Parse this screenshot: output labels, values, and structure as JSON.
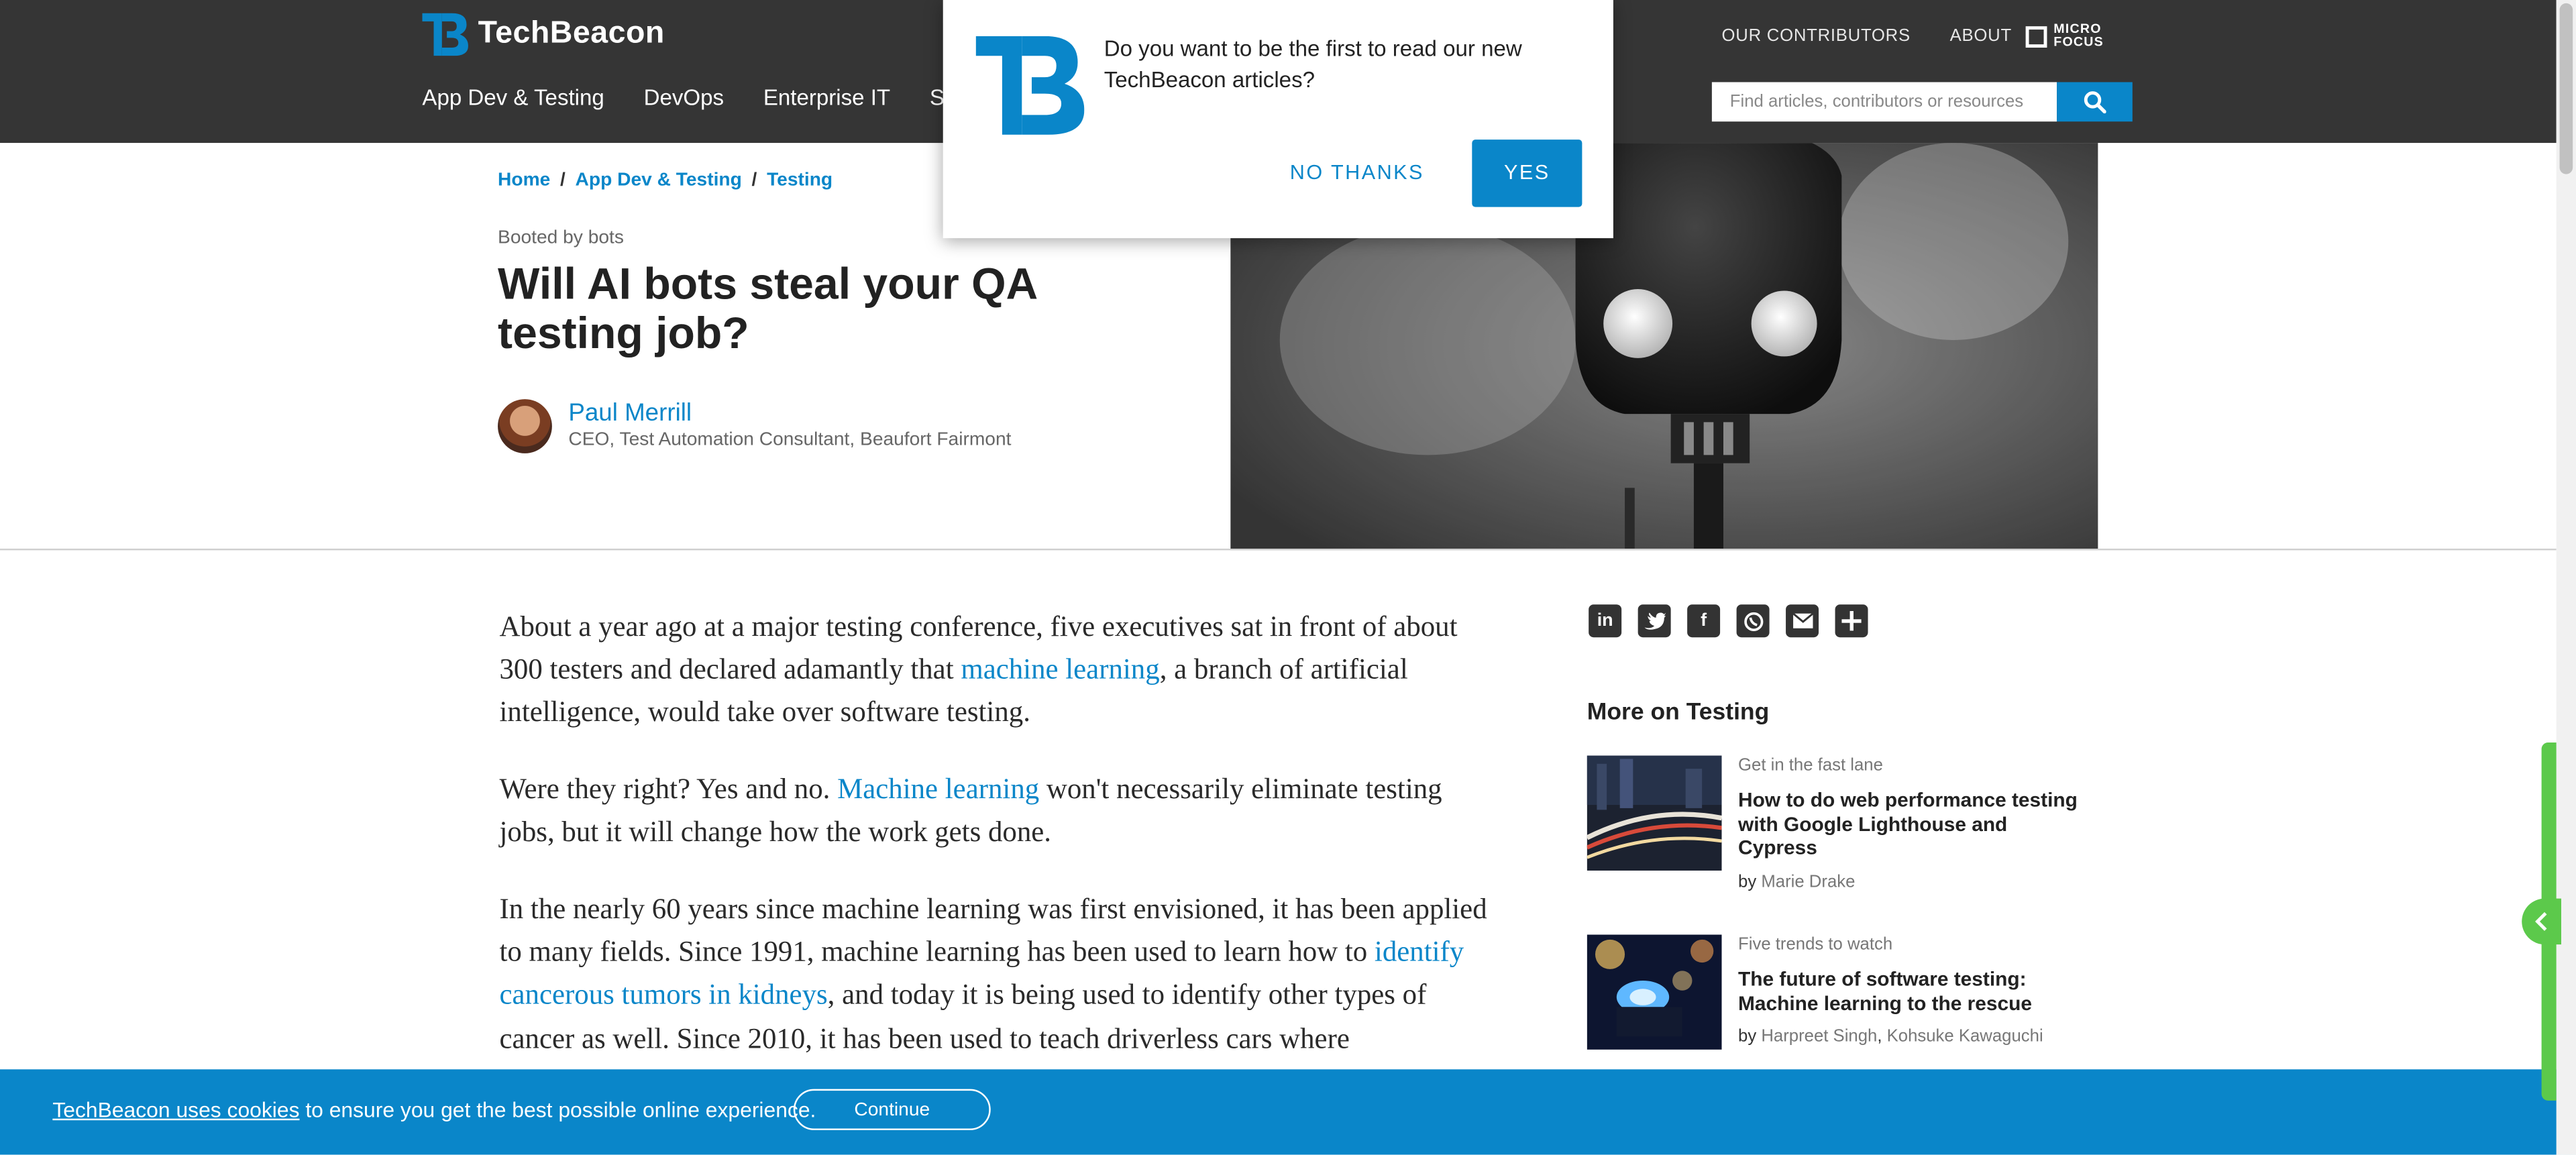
{
  "site": {
    "logo_text": "TechBeacon",
    "nav": [
      "App Dev & Testing",
      "DevOps",
      "Enterprise IT",
      "Sec"
    ],
    "top_links": [
      "OUR CONTRIBUTORS",
      "ABOUT"
    ],
    "partner_logo_text": [
      "MICRO",
      "FOCUS"
    ],
    "search_placeholder": "Find articles, contributors or resources"
  },
  "breadcrumb": {
    "items": [
      "Home",
      "App Dev & Testing",
      "Testing"
    ],
    "separator": "/"
  },
  "article": {
    "kicker": "Booted by bots",
    "title": "Will AI bots steal your QA testing job?",
    "author_name": "Paul Merrill",
    "author_role": "CEO, Test Automation Consultant, Beaufort Fairmont",
    "p1": {
      "a": "About a year ago at a major testing conference, five executives sat in front of about 300 testers and declared adamantly that ",
      "link": "machine learning",
      "b": ", a branch of artificial intelligence, would take over software testing."
    },
    "p2": {
      "a": "Were they right? Yes and no. ",
      "link": "Machine learning",
      "b": " won't necessarily eliminate testing jobs, but it will change how the work gets done."
    },
    "p3": {
      "a": "In the nearly 60 years since machine learning was first envisioned, it has been applied to many fields. Since 1991, machine learning has been used to learn how to ",
      "link": "identify cancerous tumors in kidneys",
      "b": ", and today it is being used to identify other types of cancer as well. Since 2010, it has been used to teach driverless cars where"
    }
  },
  "sidebar": {
    "share_icons": [
      "linkedin-icon",
      "twitter-icon",
      "facebook-icon",
      "whatsapp-icon",
      "email-icon",
      "plus-icon"
    ],
    "more_title": "More on Testing",
    "cards": [
      {
        "kicker": "Get in the fast lane",
        "title": "How to do web performance testing with Google Lighthouse and Cypress",
        "by": "by",
        "authors": [
          "Marie Drake"
        ]
      },
      {
        "kicker": "Five trends to watch",
        "title": "The future of software testing: Machine learning to the rescue",
        "by": "by",
        "authors": [
          "Harpreet Singh",
          "Kohsuke Kawaguchi"
        ]
      }
    ]
  },
  "popup": {
    "message": "Do you want to be the first to read our new TechBeacon articles?",
    "no_label": "NO THANKS",
    "yes_label": "YES"
  },
  "cookie": {
    "link_text": "TechBeacon uses cookies",
    "text": " to ensure you get the best possible online experience.",
    "button": "Continue"
  },
  "colors": {
    "accent": "#0a86c9",
    "header_bg": "#353535",
    "feedback_tab": "#5cc94b"
  }
}
